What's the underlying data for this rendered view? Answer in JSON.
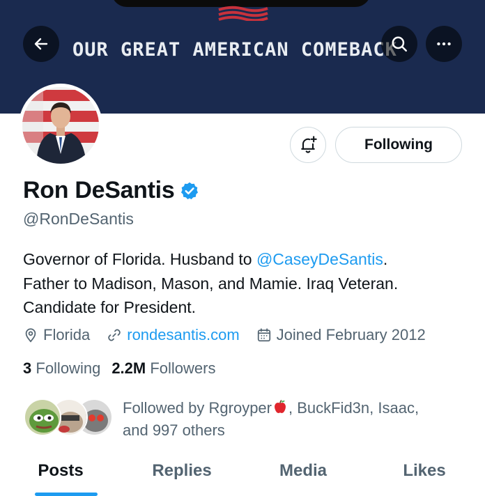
{
  "banner": {
    "text": "OUR GREAT AMERICAN COMEBACK",
    "background": "#1a2a4f"
  },
  "icons": {
    "back": "arrow-left-icon",
    "search": "search-icon",
    "more": "more-horizontal-icon",
    "notify": "bell-plus-icon",
    "verified": "verified-badge-icon",
    "location": "location-pin-icon",
    "link": "link-icon",
    "calendar": "calendar-icon"
  },
  "profile": {
    "name": "Ron DeSantis",
    "handle": "@RonDeSantis",
    "bio": {
      "line1_prefix": "Governor of Florida. Husband to ",
      "mention": "@CaseyDeSantis",
      "line1_suffix": ".",
      "line2": "Father to Madison, Mason, and Mamie. Iraq Veteran.",
      "line3": "Candidate for President."
    },
    "location": "Florida",
    "website": "rondesantis.com",
    "joined": "Joined February 2012"
  },
  "actions": {
    "following_label": "Following"
  },
  "counts": {
    "following_num": "3",
    "following_label": "Following",
    "followers_num": "2.2M",
    "followers_label": "Followers"
  },
  "followed_by": {
    "prefix": "Followed by Rgroyper",
    "rest": ", BuckFid3n, Isaac,",
    "line2": "and 997 others"
  },
  "tabs": [
    {
      "label": "Posts",
      "active": true
    },
    {
      "label": "Replies",
      "active": false
    },
    {
      "label": "Media",
      "active": false
    },
    {
      "label": "Likes",
      "active": false
    }
  ],
  "colors": {
    "accent": "#1d9bf0",
    "secondary_text": "#536471",
    "primary_text": "#0f1419",
    "border": "#cfd9de"
  }
}
